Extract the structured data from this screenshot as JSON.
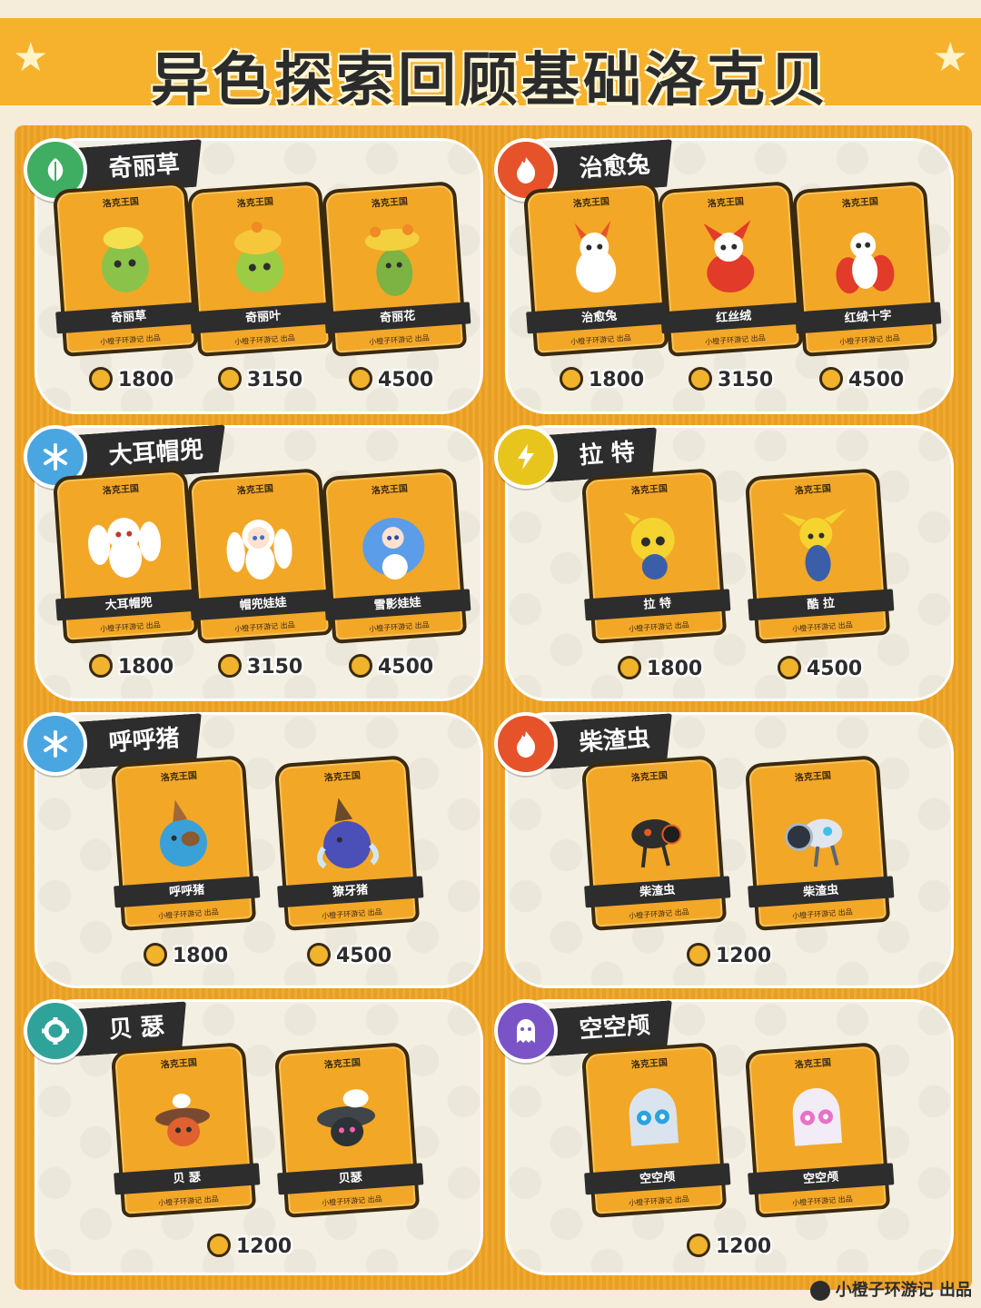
{
  "title": "异色探索回顾基础洛克贝",
  "card_logo": "洛克王国",
  "card_credit": "小橙子环游记 出品",
  "footer": "小橙子环游记 出品",
  "colors": {
    "orange": "#f6b22c",
    "dark": "#2d2d2d",
    "grass": "#3fae63",
    "fire": "#e6532b",
    "ice": "#4aa6e0",
    "electric": "#e8c51c",
    "mech": "#2fa39a",
    "ghost": "#7a54c7"
  },
  "groups": [
    {
      "name": "奇丽草",
      "type_icon": "leaf-icon",
      "cards": [
        {
          "name": "奇丽草",
          "price": "1800"
        },
        {
          "name": "奇丽叶",
          "price": "3150"
        },
        {
          "name": "奇丽花",
          "price": "4500"
        }
      ]
    },
    {
      "name": "治愈兔",
      "type_icon": "fire-icon",
      "cards": [
        {
          "name": "治愈兔",
          "price": "1800"
        },
        {
          "name": "红丝绒",
          "price": "3150"
        },
        {
          "name": "红绒十字",
          "price": "4500"
        }
      ]
    },
    {
      "name": "大耳帽兜",
      "type_icon": "snowflake-icon",
      "cards": [
        {
          "name": "大耳帽兜",
          "price": "1800"
        },
        {
          "name": "帽兜娃娃",
          "price": "3150"
        },
        {
          "name": "雪影娃娃",
          "price": "4500"
        }
      ]
    },
    {
      "name": "拉 特",
      "type_icon": "lightning-icon",
      "cards": [
        {
          "name": "拉 特",
          "price": "1800"
        },
        {
          "name": "酷 拉",
          "price": "4500"
        }
      ]
    },
    {
      "name": "呼呼猪",
      "type_icon": "snowflake-icon",
      "cards": [
        {
          "name": "呼呼猪",
          "price": "1800"
        },
        {
          "name": "獠牙猪",
          "price": "4500"
        }
      ]
    },
    {
      "name": "柴渣虫",
      "type_icon": "fire-icon",
      "cards": [
        {
          "name": "柴渣虫",
          "price": ""
        },
        {
          "name": "柴渣虫",
          "price": "1200"
        }
      ]
    },
    {
      "name": "贝 瑟",
      "type_icon": "gear-icon",
      "cards": [
        {
          "name": "贝 瑟",
          "price": ""
        },
        {
          "name": "贝瑟",
          "price": "1200"
        }
      ]
    },
    {
      "name": "空空颅",
      "type_icon": "ghost-icon",
      "cards": [
        {
          "name": "空空颅",
          "price": ""
        },
        {
          "name": "空空颅",
          "price": "1200"
        }
      ]
    }
  ]
}
